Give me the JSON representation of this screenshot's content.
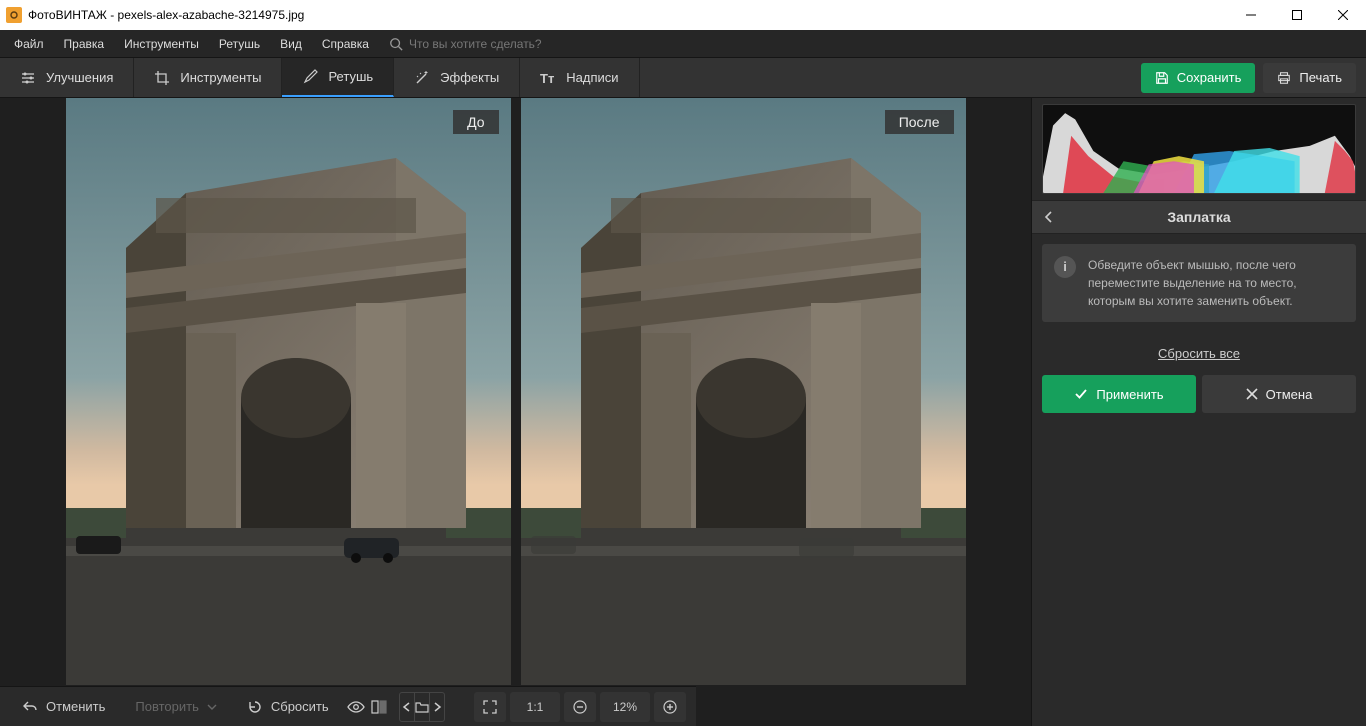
{
  "app": {
    "title": "ФотоВИНТАЖ - pexels-alex-azabache-3214975.jpg"
  },
  "menu": {
    "items": [
      "Файл",
      "Правка",
      "Инструменты",
      "Ретушь",
      "Вид",
      "Справка"
    ],
    "search_placeholder": "Что вы хотите сделать?"
  },
  "tabs": {
    "items": [
      {
        "label": "Улучшения",
        "icon": "sliders-icon"
      },
      {
        "label": "Инструменты",
        "icon": "crop-icon"
      },
      {
        "label": "Ретушь",
        "icon": "brush-icon",
        "active": true
      },
      {
        "label": "Эффекты",
        "icon": "wand-icon"
      },
      {
        "label": "Надписи",
        "icon": "text-icon"
      }
    ],
    "save": "Сохранить",
    "print": "Печать"
  },
  "canvas": {
    "before": "До",
    "after": "После"
  },
  "panel": {
    "title": "Заплатка",
    "info": "Обведите объект мышью, после чего переместите выделение на то место, которым вы хотите заменить объект.",
    "reset": "Сбросить все",
    "apply": "Применить",
    "cancel": "Отмена"
  },
  "bottom": {
    "undo": "Отменить",
    "redo": "Повторить",
    "reset": "Сбросить",
    "scale_fit": "1:1",
    "zoom": "12%"
  }
}
